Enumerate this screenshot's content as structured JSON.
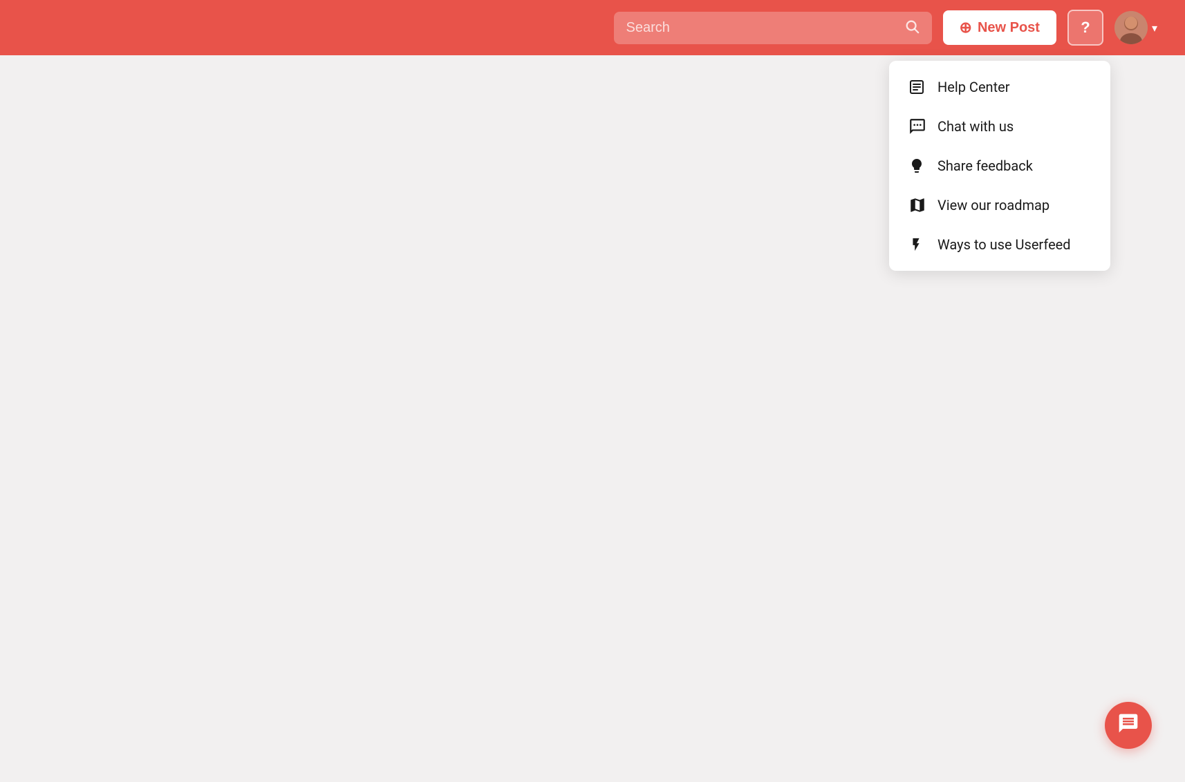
{
  "header": {
    "search_placeholder": "Search",
    "new_post_label": "New Post",
    "help_label": "?",
    "accent_color": "#e8534a"
  },
  "dropdown": {
    "items": [
      {
        "id": "help-center",
        "label": "Help Center",
        "icon": "📋"
      },
      {
        "id": "chat-with-us",
        "label": "Chat with us",
        "icon": "💬"
      },
      {
        "id": "share-feedback",
        "label": "Share feedback",
        "icon": "💡"
      },
      {
        "id": "view-roadmap",
        "label": "View our roadmap",
        "icon": "🗺"
      },
      {
        "id": "ways-to-use",
        "label": "Ways to use Userfeed",
        "icon": "⚡"
      }
    ]
  },
  "chat_widget": {
    "aria_label": "Open chat"
  }
}
